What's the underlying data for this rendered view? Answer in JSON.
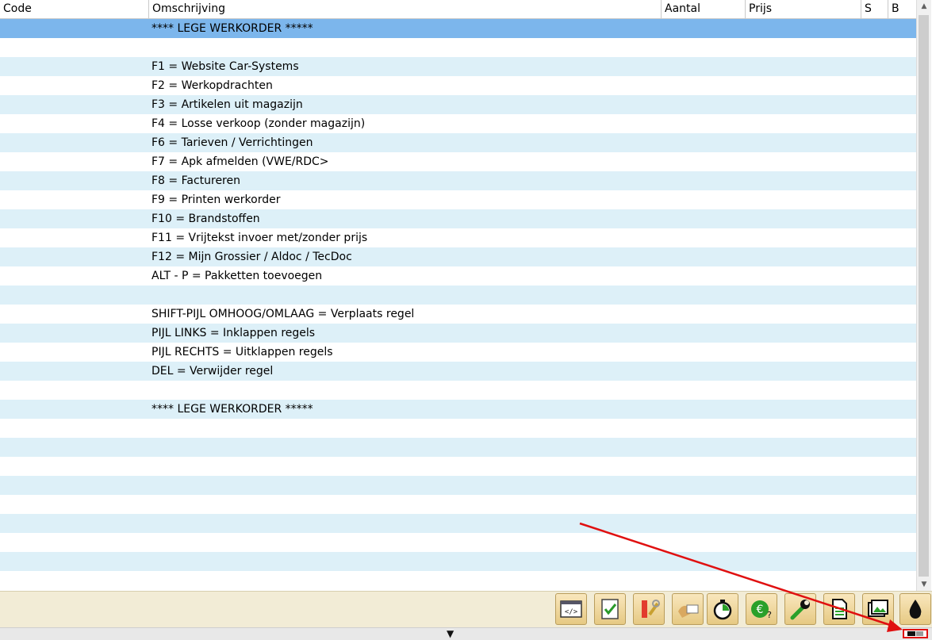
{
  "columns": {
    "code": "Code",
    "omschrijving": "Omschrijving",
    "aantal": "Aantal",
    "prijs": "Prijs",
    "s": "S",
    "b": "B"
  },
  "rows": [
    "**** LEGE WERKORDER *****",
    "",
    "F1 = Website Car-Systems",
    "F2 = Werkopdrachten",
    "F3 = Artikelen uit magazijn",
    "F4 = Losse verkoop (zonder magazijn)",
    "F6 = Tarieven / Verrichtingen",
    "F7 = Apk afmelden (VWE/RDC>",
    "F8 = Factureren",
    "F9 = Printen werkorder",
    "F10 = Brandstoffen",
    "F11 = Vrijtekst invoer met/zonder prijs",
    "F12 = Mijn Grossier / Aldoc / TecDoc",
    "ALT - P = Pakketten toevoegen",
    "",
    "SHIFT-PIJL OMHOOG/OMLAAG = Verplaats regel",
    "PIJL LINKS = Inklappen regels",
    "PIJL RECHTS = Uitklappen regels",
    "DEL = Verwijder regel",
    "",
    "**** LEGE WERKORDER *****",
    "",
    "",
    "",
    "",
    "",
    "",
    "",
    "",
    "",
    ""
  ],
  "toolbar_icons": [
    "code-view-icon",
    "checklist-icon",
    "tools-icon",
    "hand-card-icon",
    "stopwatch-icon",
    "euro-question-icon",
    "wrench-icon",
    "document-icon",
    "images-icon",
    "oil-drop-icon"
  ],
  "colors": {
    "selected_row": "#7cb6ec",
    "alt_row": "#ddf0f8",
    "toolbar_bg": "#f2ecd6",
    "annotation": "#e01010"
  }
}
